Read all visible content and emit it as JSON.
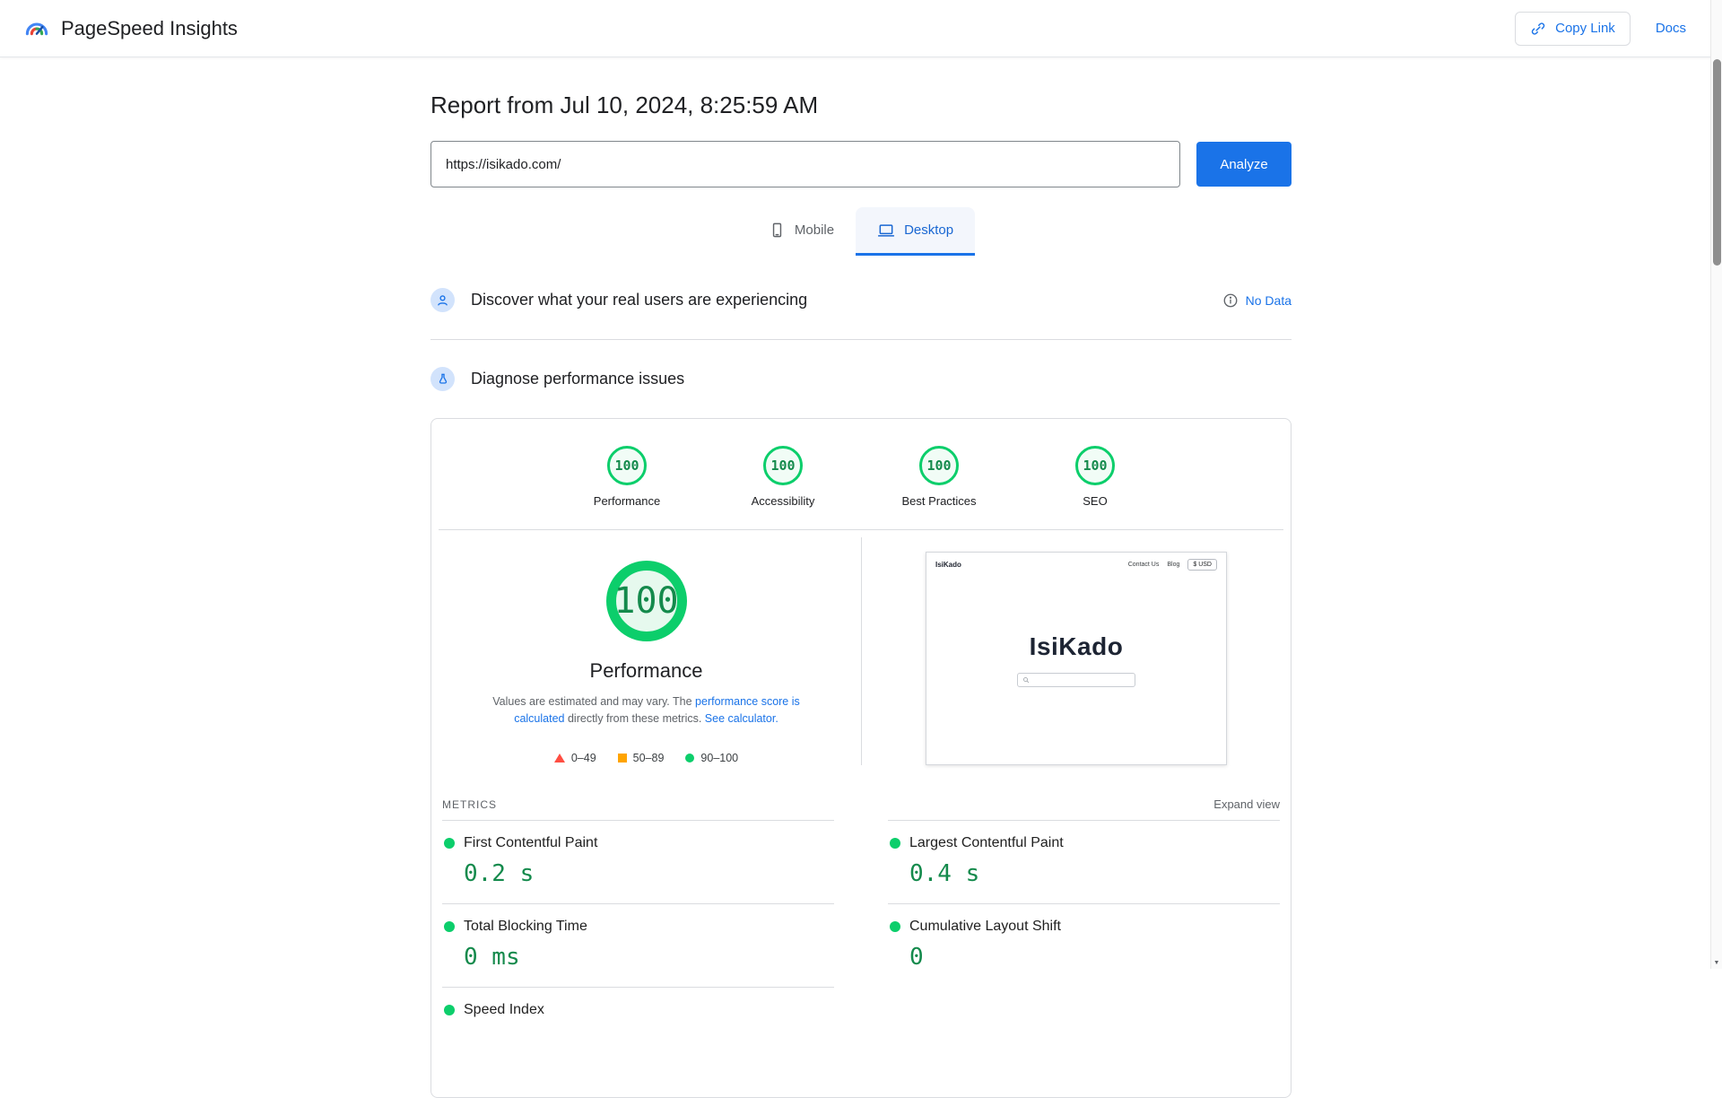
{
  "header": {
    "app_title": "PageSpeed Insights",
    "copy_link_label": "Copy Link",
    "docs_label": "Docs"
  },
  "report": {
    "title": "Report from Jul 10, 2024, 8:25:59 AM",
    "url_value": "https://isikado.com/",
    "analyze_label": "Analyze",
    "tabs": [
      {
        "label": "Mobile",
        "selected": false
      },
      {
        "label": "Desktop",
        "selected": true
      }
    ]
  },
  "field_section": {
    "title": "Discover what your real users are experiencing",
    "status_label": "No Data"
  },
  "lab_section": {
    "title": "Diagnose performance issues"
  },
  "categories": [
    {
      "label": "Performance",
      "score": "100"
    },
    {
      "label": "Accessibility",
      "score": "100"
    },
    {
      "label": "Best Practices",
      "score": "100"
    },
    {
      "label": "SEO",
      "score": "100"
    }
  ],
  "gauge": {
    "score": "100",
    "label": "Performance",
    "disclaimer_text_1": "Values are estimated and may vary. The ",
    "disclaimer_link_1": "performance score is calculated",
    "disclaimer_text_2": " directly from these metrics. ",
    "disclaimer_link_2": "See calculator.",
    "legend": [
      {
        "range": "0–49"
      },
      {
        "range": "50–89"
      },
      {
        "range": "90–100"
      }
    ]
  },
  "screenshot_preview": {
    "site_logo": "IsiKado",
    "nav_contact": "Contact Us",
    "nav_blog": "Blog",
    "currency_button": "$ USD",
    "site_title": "IsiKado"
  },
  "metrics": {
    "heading": "METRICS",
    "expand_label": "Expand view",
    "left": [
      {
        "name": "First Contentful Paint",
        "value": "0.2 s"
      },
      {
        "name": "Total Blocking Time",
        "value": "0 ms"
      },
      {
        "name": "Speed Index",
        "value": ""
      }
    ],
    "right": [
      {
        "name": "Largest Contentful Paint",
        "value": "0.4 s"
      },
      {
        "name": "Cumulative Layout Shift",
        "value": "0"
      }
    ]
  },
  "scrollbar": {
    "down_arrow": "▼"
  },
  "colors": {
    "accent_blue": "#1a73e8",
    "score_green": "#0cce6b",
    "legend_red": "#ff4e42",
    "legend_orange": "#ffa400"
  }
}
